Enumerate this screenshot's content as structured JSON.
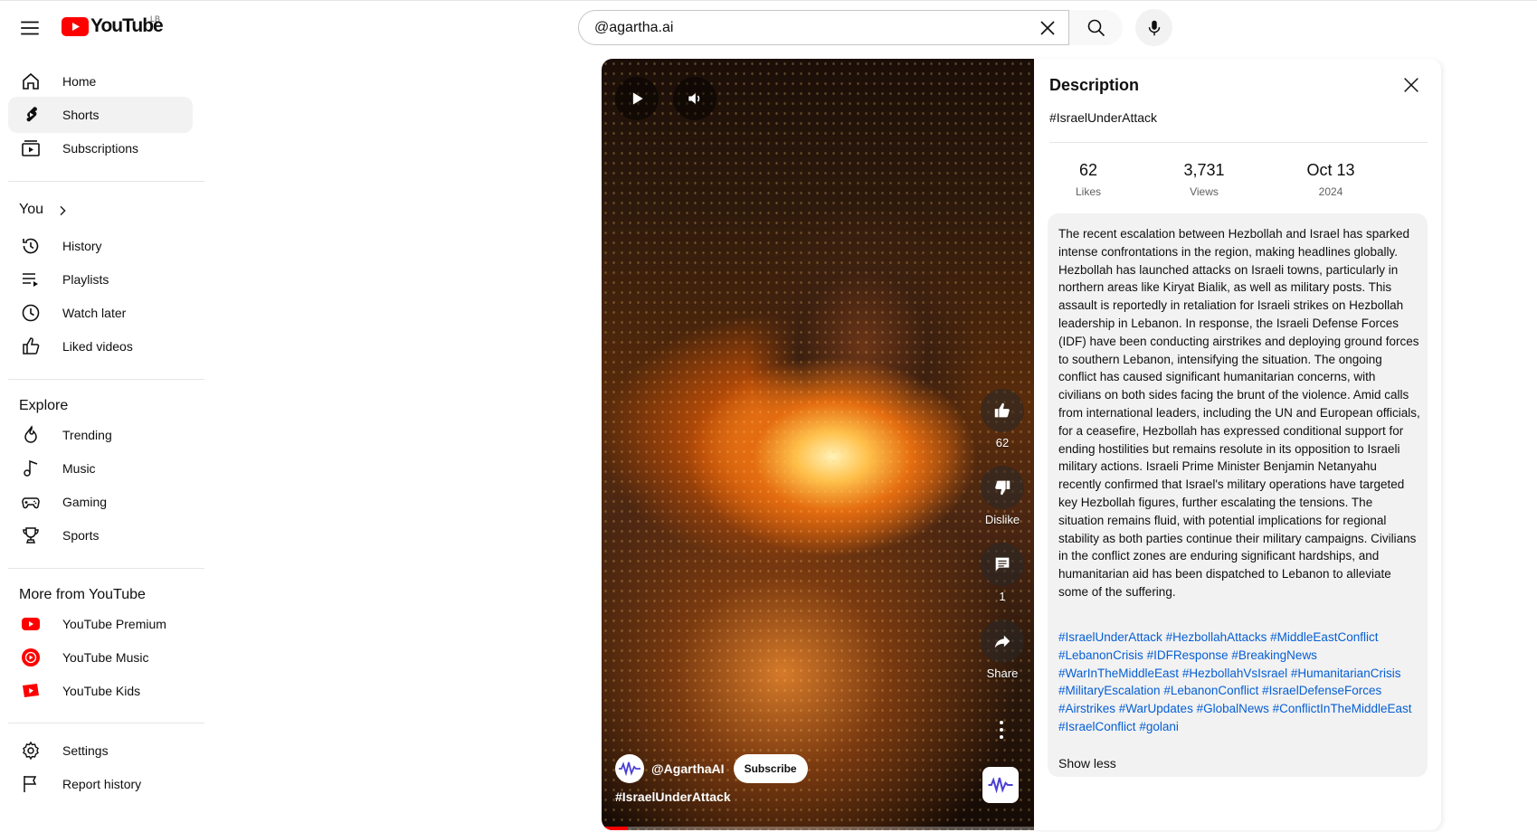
{
  "header": {
    "logo_text": "YouTube",
    "country_code": "LB",
    "search_value": "@agartha.ai",
    "search_placeholder": "Search"
  },
  "sidebar": {
    "main": [
      {
        "label": "Home",
        "icon": "home-icon"
      },
      {
        "label": "Shorts",
        "icon": "shorts-icon",
        "active": true
      },
      {
        "label": "Subscriptions",
        "icon": "subscriptions-icon"
      }
    ],
    "you_title": "You",
    "you_items": [
      {
        "label": "History",
        "icon": "history-icon"
      },
      {
        "label": "Playlists",
        "icon": "playlists-icon"
      },
      {
        "label": "Watch later",
        "icon": "watch-later-icon"
      },
      {
        "label": "Liked videos",
        "icon": "liked-videos-icon"
      }
    ],
    "explore_title": "Explore",
    "explore_items": [
      {
        "label": "Trending",
        "icon": "trending-icon"
      },
      {
        "label": "Music",
        "icon": "music-icon"
      },
      {
        "label": "Gaming",
        "icon": "gaming-icon"
      },
      {
        "label": "Sports",
        "icon": "sports-icon"
      }
    ],
    "more_title": "More from YouTube",
    "more_items": [
      {
        "label": "YouTube Premium",
        "icon": "youtube-premium-icon"
      },
      {
        "label": "YouTube Music",
        "icon": "youtube-music-icon"
      },
      {
        "label": "YouTube Kids",
        "icon": "youtube-kids-icon"
      }
    ],
    "bottom_items": [
      {
        "label": "Settings",
        "icon": "settings-icon"
      },
      {
        "label": "Report history",
        "icon": "report-history-icon"
      }
    ]
  },
  "short": {
    "channel_name": "@AgarthaAI",
    "subscribe_label": "Subscribe",
    "title": "#IsraelUnderAttack",
    "progress_fraction": 0.06,
    "actions": {
      "likes": "62",
      "dislike": "Dislike",
      "comments": "1",
      "share": "Share"
    }
  },
  "description": {
    "header": "Description",
    "tag": "#IsraelUnderAttack",
    "stats": [
      {
        "value": "62",
        "label": "Likes"
      },
      {
        "value": "3,731",
        "label": "Views"
      },
      {
        "value": "Oct 13",
        "label": "2024"
      }
    ],
    "text": "The recent escalation between Hezbollah and Israel has sparked intense confrontations in the region, making headlines globally. Hezbollah has launched attacks on Israeli towns, particularly in northern areas like Kiryat Bialik, as well as military posts. This assault is reportedly in retaliation for Israeli strikes on Hezbollah leadership in Lebanon. In response, the Israeli Defense Forces (IDF) have been conducting airstrikes and deploying ground forces to southern Lebanon, intensifying the situation. The ongoing conflict has caused significant humanitarian concerns, with civilians on both sides facing the brunt of the violence. Amid calls from international leaders, including the UN and European officials, for a ceasefire, Hezbollah has expressed conditional support for ending hostilities but remains resolute in its opposition to Israeli military actions. Israeli Prime Minister Benjamin Netanyahu recently confirmed that Israel's military operations have targeted key Hezbollah figures, further escalating the tensions. The situation remains fluid, with potential implications for regional stability as both parties continue their military campaigns. Civilians in the conflict zones are enduring significant hardships, and humanitarian aid has been dispatched to Lebanon to alleviate some of the suffering.",
    "hashtags": [
      "#IsraelUnderAttack",
      "#HezbollahAttacks",
      "#MiddleEastConflict",
      "#LebanonCrisis",
      "#IDFResponse",
      "#BreakingNews",
      "#WarInTheMiddleEast",
      "#HezbollahVsIsrael",
      "#HumanitarianCrisis",
      "#MilitaryEscalation",
      "#LebanonConflict",
      "#IsraelDefenseForces",
      "#Airstrikes",
      "#WarUpdates",
      "#GlobalNews",
      "#ConflictInTheMiddleEast",
      "#IsraelConflict",
      "#golani"
    ],
    "show_less": "Show less"
  },
  "colors": {
    "brand_red": "#ff0000",
    "link_blue": "#065fd4",
    "active_bg": "#f2f2f2"
  }
}
